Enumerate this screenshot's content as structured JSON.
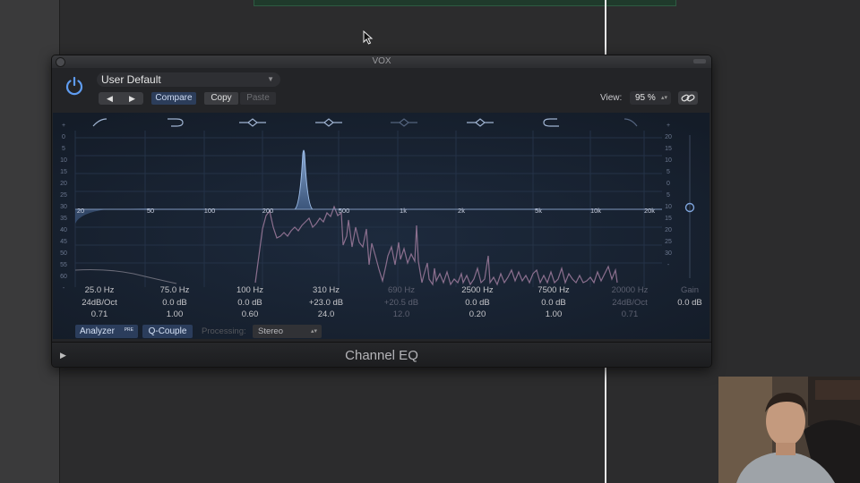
{
  "window": {
    "title": "VOX"
  },
  "toolbar": {
    "preset": "User Default",
    "prev_glyph": "◀",
    "next_glyph": "▶",
    "compare_label": "Compare",
    "copy_label": "Copy",
    "paste_label": "Paste",
    "view_label": "View:",
    "view_value": "95 %"
  },
  "graph": {
    "db_scale_left": [
      "+",
      "0",
      "5",
      "10",
      "15",
      "20",
      "25",
      "30",
      "35",
      "40",
      "45",
      "50",
      "55",
      "60",
      "-"
    ],
    "db_scale_right": [
      "+",
      "20",
      "15",
      "10",
      "5",
      "0",
      "5",
      "10",
      "15",
      "20",
      "25",
      "30",
      "-"
    ],
    "freq_labels": [
      "20",
      "50",
      "100",
      "200",
      "500",
      "1k",
      "2k",
      "5k",
      "10k",
      "20k"
    ]
  },
  "bands": [
    {
      "freq": "25.0 Hz",
      "gain": "24dB/Oct",
      "q": "0.71",
      "enabled": true
    },
    {
      "freq": "75.0 Hz",
      "gain": "0.0 dB",
      "q": "1.00",
      "enabled": true
    },
    {
      "freq": "100 Hz",
      "gain": "0.0 dB",
      "q": "0.60",
      "enabled": true
    },
    {
      "freq": "310 Hz",
      "gain": "+23.0 dB",
      "q": "24.0",
      "enabled": true
    },
    {
      "freq": "690 Hz",
      "gain": "+20.5 dB",
      "q": "12.0",
      "enabled": false
    },
    {
      "freq": "2500 Hz",
      "gain": "0.0 dB",
      "q": "0.20",
      "enabled": true
    },
    {
      "freq": "7500 Hz",
      "gain": "0.0 dB",
      "q": "1.00",
      "enabled": true
    },
    {
      "freq": "20000 Hz",
      "gain": "24dB/Oct",
      "q": "0.71",
      "enabled": false
    }
  ],
  "master_gain": {
    "label": "Gain",
    "value": "0.0 dB"
  },
  "bottom": {
    "analyzer_label": "Analyzer",
    "analyzer_badge": "PRE",
    "q_couple_label": "Q-Couple",
    "processing_label": "Processing:",
    "processing_value": "Stereo"
  },
  "footer": {
    "plugin_name": "Channel EQ"
  },
  "colors": {
    "accent": "#2b3d5c",
    "curve": "#6f86b0",
    "spectrum": "#8b6f8e",
    "playhead": "#e8e8e8"
  }
}
